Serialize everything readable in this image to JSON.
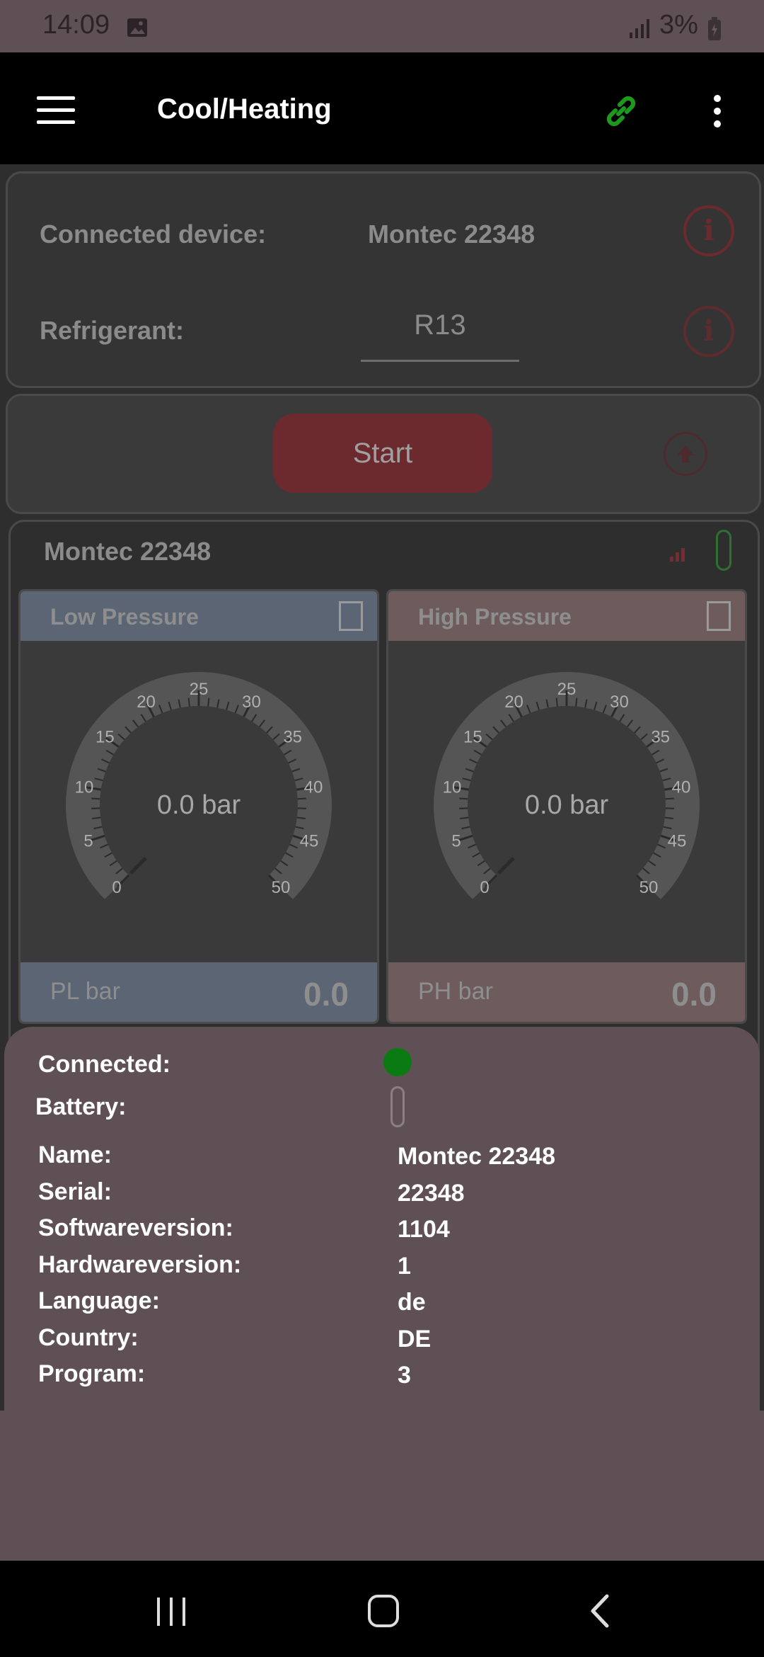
{
  "status_bar": {
    "time": "14:09",
    "battery_pct": "3%",
    "icons": [
      "image-icon",
      "signal-icon",
      "battery-charging-icon"
    ]
  },
  "app_bar": {
    "title": "Cool/Heating",
    "icons": [
      "menu-icon",
      "link-icon",
      "more-vert-icon"
    ],
    "link_color": "#1d9a1d"
  },
  "device_card": {
    "connected_label": "Connected device:",
    "connected_value": "Montec 22348",
    "refrigerant_label": "Refrigerant:",
    "refrigerant_value": "R13",
    "info_icon_glyph": "i"
  },
  "start_card": {
    "start_label": "Start"
  },
  "gauges": {
    "device_name": "Montec 22348",
    "low": {
      "title": "Low Pressure",
      "header_color": "#5b6573",
      "footer_label": "PL bar",
      "footer_value": "0.0",
      "center_text": "0.0 bar",
      "value": 0,
      "min": 0,
      "max": 50,
      "ticks": [
        "0",
        "5",
        "10",
        "15",
        "20",
        "25",
        "30",
        "35",
        "40",
        "45",
        "50"
      ]
    },
    "high": {
      "title": "High Pressure",
      "header_color": "#6e5b5c",
      "footer_label": "PH bar",
      "footer_value": "0.0",
      "center_text": "0.0 bar",
      "value": 0,
      "min": 0,
      "max": 50,
      "ticks": [
        "0",
        "5",
        "10",
        "15",
        "20",
        "25",
        "30",
        "35",
        "40",
        "45",
        "50"
      ]
    }
  },
  "sheet": {
    "connected_label": "Connected:",
    "connected_status_color": "#0a7a12",
    "battery_label": "Battery:",
    "rows": [
      {
        "label": "Name:",
        "value": "Montec 22348"
      },
      {
        "label": "Serial:",
        "value": "22348"
      },
      {
        "label": "Softwareversion:",
        "value": "1104"
      },
      {
        "label": "Hardwareversion:",
        "value": "1"
      },
      {
        "label": "Language:",
        "value": "de"
      },
      {
        "label": "Country:",
        "value": "DE"
      },
      {
        "label": "Program:",
        "value": "3"
      }
    ]
  },
  "nav_bar": {
    "icons": [
      "recents-icon",
      "home-icon",
      "back-icon"
    ]
  }
}
